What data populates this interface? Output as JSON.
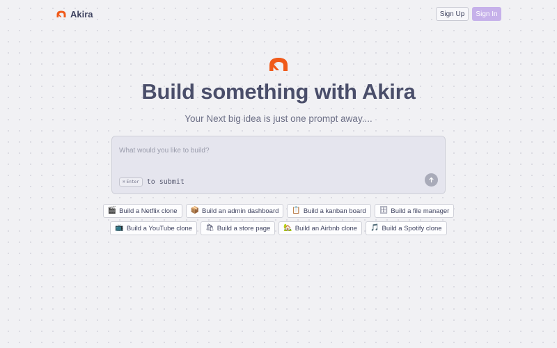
{
  "header": {
    "brand_name": "Akira",
    "signup_label": "Sign Up",
    "signin_label": "Sign In"
  },
  "hero": {
    "title": "Build something with Akira",
    "subtitle": "Your Next big idea is just one prompt away...."
  },
  "prompt": {
    "placeholder": "What would you like to build?",
    "value": "",
    "kbd_key": "Enter",
    "hint_text": "to submit"
  },
  "suggestions": [
    {
      "icon": "clapper-board-icon",
      "glyph": "🎬",
      "label": "Build a Netflix clone"
    },
    {
      "icon": "package-icon",
      "glyph": "📦",
      "label": "Build an admin dashboard"
    },
    {
      "icon": "clipboard-icon",
      "glyph": "📋",
      "label": "Build a kanban board"
    },
    {
      "icon": "file-cabinet-icon",
      "glyph": "🗄",
      "label": "Build a file manager"
    },
    {
      "icon": "television-icon",
      "glyph": "📺",
      "label": "Build a YouTube clone"
    },
    {
      "icon": "shopping-bags-icon",
      "glyph": "🛍",
      "label": "Build a store page"
    },
    {
      "icon": "house-icon",
      "glyph": "🏡",
      "label": "Build an Airbnb clone"
    },
    {
      "icon": "music-note-icon",
      "glyph": "🎵",
      "label": "Build a Spotify clone"
    }
  ],
  "colors": {
    "accent": "#f05a1a",
    "signin_bg": "#c6b1ea",
    "title": "#4a4e6a"
  }
}
